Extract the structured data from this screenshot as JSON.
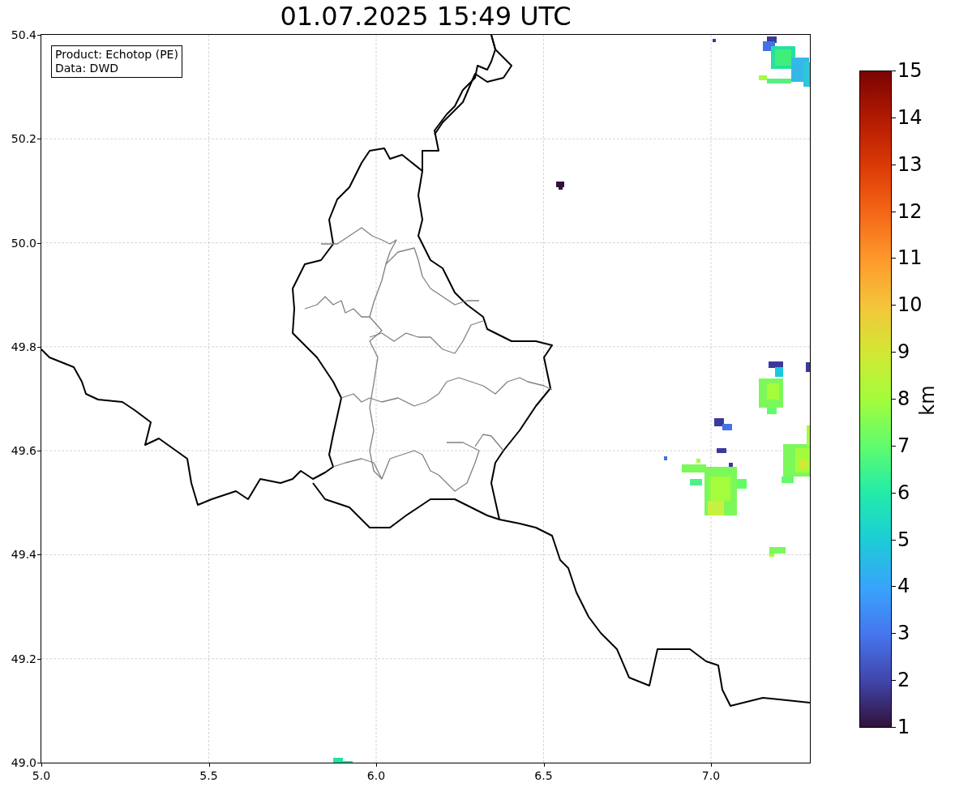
{
  "title": "01.07.2025 15:49 UTC",
  "info_box": {
    "lines": [
      "Product: Echotop (PE)",
      "Data: DWD"
    ]
  },
  "map": {
    "xtick_labels": [
      "5.0",
      "5.5",
      "6.0",
      "6.5",
      "7.0"
    ],
    "ytick_labels": [
      "50.4",
      "50.2",
      "50.0",
      "49.8",
      "49.6",
      "49.4",
      "49.2",
      "49.0"
    ]
  },
  "colorbar": {
    "label": "km",
    "tick_labels": [
      "15",
      "14",
      "13",
      "12",
      "11",
      "10",
      "9",
      "8",
      "7",
      "6",
      "5",
      "4",
      "3",
      "2",
      "1"
    ]
  }
}
